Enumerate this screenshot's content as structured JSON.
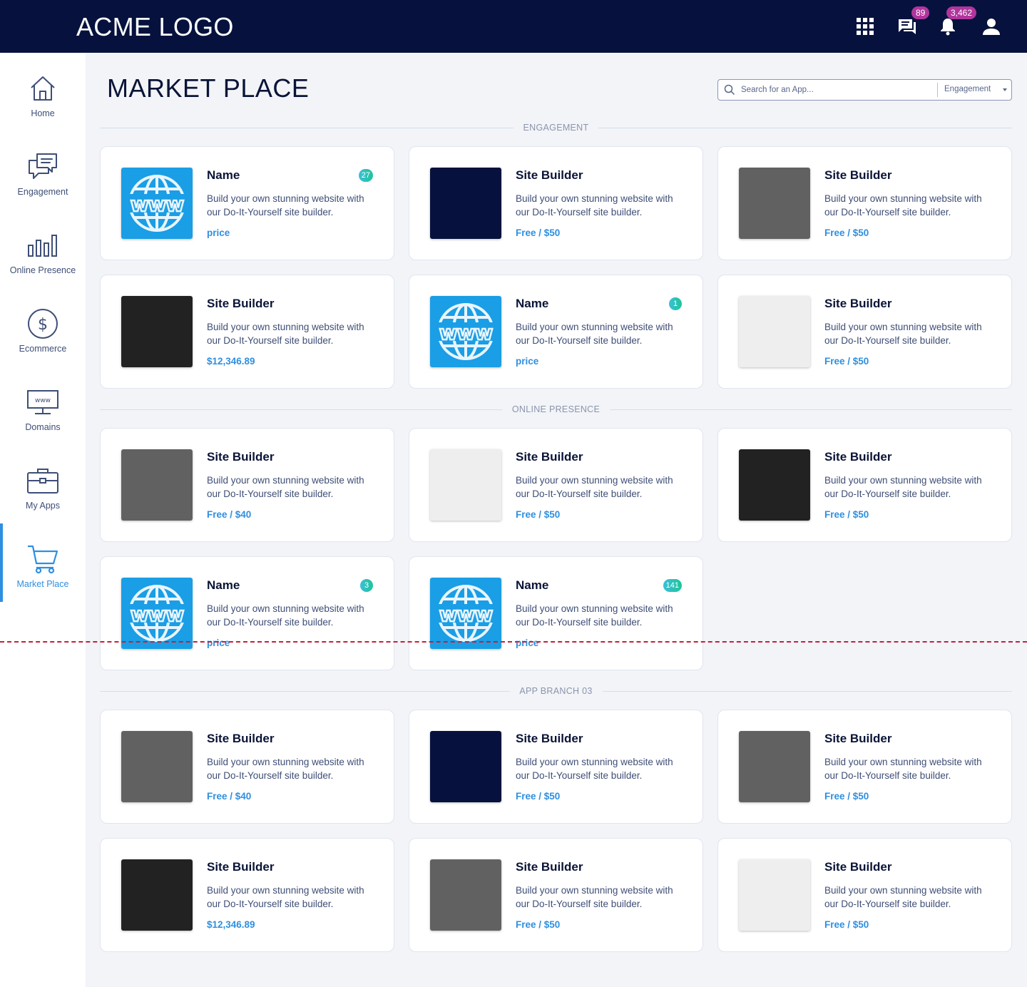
{
  "header": {
    "logo": "ACME LOGO",
    "messages_badge": "89",
    "notifications_badge": "3,462"
  },
  "sidebar": {
    "items": [
      {
        "label": "Home",
        "icon": "home-icon"
      },
      {
        "label": "Engagement",
        "icon": "chat-bubbles-icon"
      },
      {
        "label": "Online Presence",
        "icon": "bar-chart-icon"
      },
      {
        "label": "Ecommerce",
        "icon": "dollar-icon"
      },
      {
        "label": "Domains",
        "icon": "monitor-www-icon"
      },
      {
        "label": "My Apps",
        "icon": "briefcase-icon"
      },
      {
        "label": "Market Place",
        "icon": "cart-icon"
      }
    ],
    "active_index": 6
  },
  "page": {
    "title": "MARKET PLACE",
    "search_placeholder": "Search for an App...",
    "category_select": "Engagement"
  },
  "sections": [
    {
      "title": "ENGAGEMENT",
      "cards": [
        {
          "title": "Name",
          "desc": "Build your own stunning website with our Do-It-Yourself site builder.",
          "price": "price",
          "badge": "27",
          "thumb": "www"
        },
        {
          "title": "Site Builder",
          "desc": "Build your own stunning website with our Do-It-Yourself site builder.",
          "price": "Free / $50",
          "badge": "",
          "thumb": "#06123d"
        },
        {
          "title": "Site Builder",
          "desc": "Build your own stunning website with our Do-It-Yourself site builder.",
          "price": "Free / $50",
          "badge": "",
          "thumb": "#616161"
        },
        {
          "title": "Site Builder",
          "desc": "Build your own stunning website with our Do-It-Yourself site builder.",
          "price": "$12,346.89",
          "badge": "",
          "thumb": "#222222"
        },
        {
          "title": "Name",
          "desc": "Build your own stunning website with our Do-It-Yourself site builder.",
          "price": "price",
          "badge": "1",
          "thumb": "www"
        },
        {
          "title": "Site Builder",
          "desc": "Build your own stunning website with our Do-It-Yourself site builder.",
          "price": "Free / $50",
          "badge": "",
          "thumb": "#eeeeee"
        }
      ]
    },
    {
      "title": "ONLINE PRESENCE",
      "cards": [
        {
          "title": "Site Builder",
          "desc": "Build your own stunning website with our Do-It-Yourself site builder.",
          "price": "Free / $40",
          "badge": "",
          "thumb": "#616161"
        },
        {
          "title": "Site Builder",
          "desc": "Build your own stunning website with our Do-It-Yourself site builder.",
          "price": "Free / $50",
          "badge": "",
          "thumb": "#eeeeee"
        },
        {
          "title": "Site Builder",
          "desc": "Build your own stunning website with our Do-It-Yourself site builder.",
          "price": "Free / $50",
          "badge": "",
          "thumb": "#222222"
        },
        {
          "title": "Name",
          "desc": "Build your own stunning website with our Do-It-Yourself site builder.",
          "price": "price",
          "badge": "3",
          "thumb": "www"
        },
        {
          "title": "Name",
          "desc": "Build your own stunning website with our Do-It-Yourself site builder.",
          "price": "price",
          "badge": "141",
          "thumb": "www"
        }
      ]
    },
    {
      "title": "APP BRANCH 03",
      "cards": [
        {
          "title": "Site Builder",
          "desc": "Build your own stunning website with our Do-It-Yourself site builder.",
          "price": "Free / $40",
          "badge": "",
          "thumb": "#616161"
        },
        {
          "title": "Site Builder",
          "desc": "Build your own stunning website with our Do-It-Yourself site builder.",
          "price": "Free / $50",
          "badge": "",
          "thumb": "#06123d"
        },
        {
          "title": "Site Builder",
          "desc": "Build your own stunning website with our Do-It-Yourself site builder.",
          "price": "Free / $50",
          "badge": "",
          "thumb": "#616161"
        },
        {
          "title": "Site Builder",
          "desc": "Build your own stunning website with our Do-It-Yourself site builder.",
          "price": "$12,346.89",
          "badge": "",
          "thumb": "#222222"
        },
        {
          "title": "Site Builder",
          "desc": "Build your own stunning website with our Do-It-Yourself site builder.",
          "price": "Free / $50",
          "badge": "",
          "thumb": "#616161"
        },
        {
          "title": "Site Builder",
          "desc": "Build your own stunning website with our Do-It-Yourself site builder.",
          "price": "Free / $50",
          "badge": "",
          "thumb": "#eeeeee"
        }
      ]
    }
  ],
  "colors": {
    "header_bg": "#06123d",
    "accent": "#2f8fe0",
    "badge_pink": "#b0359c",
    "www_blue": "#1a9ee6"
  }
}
